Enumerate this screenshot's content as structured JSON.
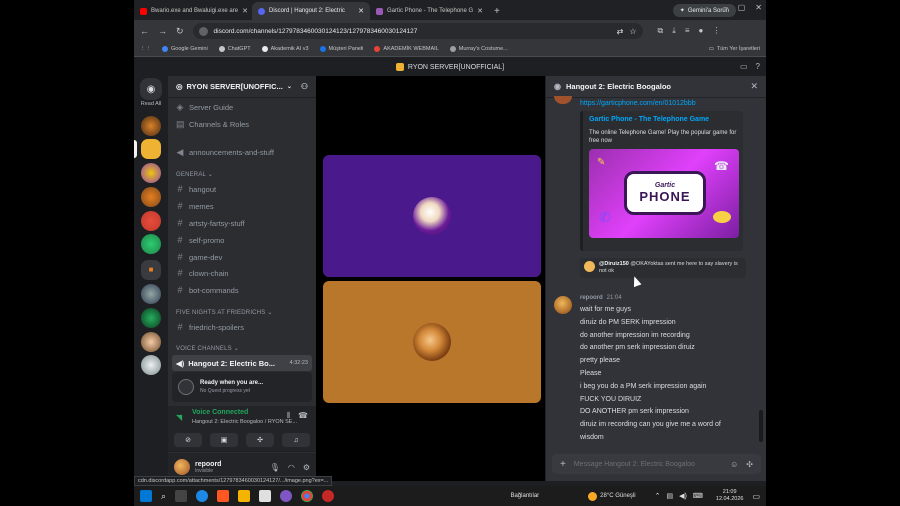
{
  "browser": {
    "tabs": [
      {
        "title": "Bwario.exe and Bwaluigi.exe are",
        "favicon_color": "#ff0000",
        "active": false
      },
      {
        "title": "Discord | Hangout 2: Electric",
        "favicon_color": "#5865f2",
        "active": true
      },
      {
        "title": "Gartic Phone - The Telephone G",
        "favicon_color": "#9b59b6",
        "active": false
      }
    ],
    "new_tab": "+",
    "gemini_label": "Gemini'a Sorun",
    "url": "discord.com/channels/1279783460030124123/1279783460030124127",
    "bookmarks": [
      "Google Gemini",
      "ChatGPT",
      "Akademik AI v3",
      "Müşteri Paneli",
      "AKADEMİK WEBMAIL",
      "Murray's Costume..."
    ],
    "bookmarks_right": "Tüm Yer İşaretleri",
    "status_url": "cdn.discordapp.com/attachments/1279783460030124127/.../image.png?ex=..."
  },
  "discord": {
    "window_title": "RYON SERVER[UNOFFICIAL]",
    "read_all": "Read All",
    "server_name": "RYON SERVER[UNOFFIC...",
    "channels_top": [
      {
        "icon": "guide",
        "label": "Server Guide"
      },
      {
        "icon": "list",
        "label": "Channels & Roles"
      },
      {
        "icon": "megaphone",
        "label": "announcements-and-stuff"
      }
    ],
    "category_general": "GENERAL",
    "general_channels": [
      "hangout",
      "memes",
      "artsty-fartsy-stuff",
      "self-promo",
      "game-dev",
      "clown-chain",
      "bot-commands"
    ],
    "category_fnaf": "FIVE NIGHTS AT FRIEDRICHS",
    "fnaf_channels": [
      "friedrich-spoilers"
    ],
    "category_voice": "VOICE CHANNELS",
    "voice_channel": {
      "label": "Hangout 2: Electric Bo...",
      "timer": "4:32:23"
    },
    "quest": {
      "title": "Ready when you are...",
      "subtitle": "No Quest progress yet"
    },
    "voice_connected": {
      "title": "Voice Connected",
      "subtitle": "Hangout 2: Electric Boogaloo / RYON SE..."
    },
    "user": {
      "name": "repoord",
      "status": "Invisible"
    },
    "thread": {
      "title": "Hangout 2: Electric Boogaloo",
      "link": "https://garticphone.com/en/01012bbb",
      "embed_title": "Gartic Phone - The Telephone Game",
      "embed_desc": "The online Telephone Game! Play the popular game for free now",
      "logo_top": "Gartic",
      "logo_bottom": "PHONE",
      "reply_author": "@Diruiz150",
      "reply_text": "@OKAYoktas sent me here to say slavery is not ok",
      "msg_author": "repoord",
      "msg_time": "21:04",
      "messages": [
        "wait for me guys",
        "diruiz do  PM SERK impression",
        "do another impression im recording",
        "do another pm serk impression diruiz",
        "pretty please",
        "Please",
        "i beg you do a PM serk impression again",
        "FUCK YOU DIRUIZ",
        "DO ANOTHER pm serk impression",
        "diruiz im recording can you give me a word of",
        "wisdom"
      ],
      "composer_placeholder": "Message Hangout 2: Electric Boogaloo"
    }
  },
  "taskbar": {
    "label": "Bağlantılar",
    "weather": "28°C  Güneşli",
    "time": "21:09",
    "date": "12.04.2026"
  }
}
